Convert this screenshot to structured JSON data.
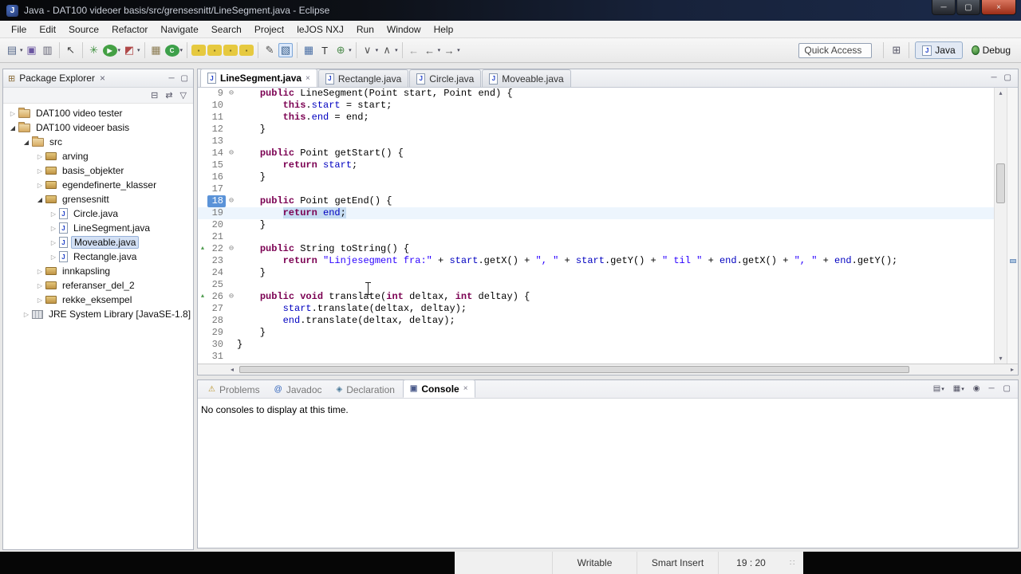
{
  "window": {
    "title": "Java - DAT100 videoer basis/src/grensesnitt/LineSegment.java - Eclipse",
    "app_icon_letter": "J",
    "controls": {
      "minimize": "─",
      "maximize": "▢",
      "close": "×"
    }
  },
  "glyphs": {
    "dropdown": "▾",
    "expander_open": "◢",
    "expander_closed": "▷",
    "fold": "⊖",
    "override_marker": "▲",
    "scroll_up": "▴",
    "scroll_down": "▾",
    "scroll_left": "◂",
    "scroll_right": "▸",
    "minimize": "─",
    "maximize": "▢",
    "close": "×",
    "handle_dots": "∷"
  },
  "menu": {
    "items": [
      "File",
      "Edit",
      "Source",
      "Refactor",
      "Navigate",
      "Search",
      "Project",
      "leJOS NXJ",
      "Run",
      "Window",
      "Help"
    ]
  },
  "toolbar": {
    "quick_access": "Quick Access",
    "icons": [
      {
        "name": "new-wizard",
        "glyph": "▤",
        "color": "#56688a",
        "dd": true
      },
      {
        "name": "save",
        "glyph": "▣",
        "color": "#6a55a0"
      },
      {
        "name": "print",
        "glyph": "▥",
        "color": "#667",
        "sepAfter": true
      },
      {
        "name": "selection-tool",
        "glyph": "↖",
        "color": "#444",
        "sepAfter": true
      },
      {
        "name": "debug",
        "glyph": "✳",
        "color": "#3c8f3c"
      },
      {
        "name": "run",
        "glyph": "▶",
        "color": "#ffffff",
        "bg": "#44a044",
        "circle": true,
        "dd": true
      },
      {
        "name": "coverage",
        "glyph": "◩",
        "color": "#b04848",
        "dd": true,
        "sepAfter": true
      },
      {
        "name": "new-java-project",
        "glyph": "▦",
        "color": "#8a7a50"
      },
      {
        "name": "new-class",
        "glyph": "C",
        "color": "#ffffff",
        "bg": "#3da04a",
        "circle": true,
        "dd": true,
        "sepAfter": true
      },
      {
        "name": "lejos-compile",
        "glyph": "▪",
        "color": "#7a6a20",
        "bg": "#e6c93f",
        "box": true
      },
      {
        "name": "lejos-upload",
        "glyph": "▪",
        "color": "#7a6a20",
        "bg": "#e6c93f",
        "box": true
      },
      {
        "name": "lejos-console",
        "glyph": "▪",
        "color": "#7a6a20",
        "bg": "#e6c93f",
        "box": true
      },
      {
        "name": "lejos-flash",
        "glyph": "▪",
        "color": "#7a6a20",
        "bg": "#e6c93f",
        "box": true,
        "sepAfter": true
      },
      {
        "name": "edit-pen",
        "glyph": "✎",
        "color": "#555"
      },
      {
        "name": "capture",
        "glyph": "▧",
        "color": "#3a5f8a",
        "pressed": true,
        "sepAfter": true
      },
      {
        "name": "new-table",
        "glyph": "▦",
        "color": "#4a6fa5"
      },
      {
        "name": "text-tool",
        "glyph": "T",
        "color": "#333"
      },
      {
        "name": "new-type",
        "glyph": "⊕",
        "color": "#4a8a4a",
        "dd": true,
        "sepAfter": true
      },
      {
        "name": "next-annotation",
        "glyph": "∨",
        "color": "#555",
        "dd": true
      },
      {
        "name": "prev-annotation",
        "glyph": "∧",
        "color": "#555",
        "dd": true,
        "sepAfter": true
      },
      {
        "name": "last-edit-location",
        "glyph": "←",
        "color": "#999"
      },
      {
        "name": "back-history",
        "glyph": "←",
        "color": "#555",
        "dd": true
      },
      {
        "name": "forward-history",
        "glyph": "→",
        "color": "#555",
        "dd": true
      }
    ],
    "perspectives": {
      "open_glyph": "⊞",
      "items": [
        {
          "name": "java",
          "label": "Java",
          "active": true
        },
        {
          "name": "debug",
          "label": "Debug",
          "active": false
        }
      ]
    }
  },
  "package_explorer": {
    "title": "Package Explorer",
    "view_toolbar": [
      {
        "name": "collapse-all",
        "glyph": "⊟"
      },
      {
        "name": "link-with-editor",
        "glyph": "⇄"
      },
      {
        "name": "view-menu",
        "glyph": "▽"
      }
    ],
    "tree": [
      {
        "label": "DAT100 video tester",
        "depth": 0,
        "exp": "closed",
        "icon": "project"
      },
      {
        "label": "DAT100 videoer basis",
        "depth": 0,
        "exp": "open",
        "icon": "project"
      },
      {
        "label": "src",
        "depth": 1,
        "exp": "open",
        "icon": "srcfolder"
      },
      {
        "label": "arving",
        "depth": 2,
        "exp": "closed",
        "icon": "package"
      },
      {
        "label": "basis_objekter",
        "depth": 2,
        "exp": "closed",
        "icon": "package"
      },
      {
        "label": "egendefinerte_klasser",
        "depth": 2,
        "exp": "closed",
        "icon": "package"
      },
      {
        "label": "grensesnitt",
        "depth": 2,
        "exp": "open",
        "icon": "package"
      },
      {
        "label": "Circle.java",
        "depth": 3,
        "exp": "closed",
        "icon": "jfile"
      },
      {
        "label": "LineSegment.java",
        "depth": 3,
        "exp": "closed",
        "icon": "jfile"
      },
      {
        "label": "Moveable.java",
        "depth": 3,
        "exp": "closed",
        "icon": "jfile",
        "selected": true
      },
      {
        "label": "Rectangle.java",
        "depth": 3,
        "exp": "closed",
        "icon": "jfile"
      },
      {
        "label": "innkapsling",
        "depth": 2,
        "exp": "closed",
        "icon": "package"
      },
      {
        "label": "referanser_del_2",
        "depth": 2,
        "exp": "closed",
        "icon": "package"
      },
      {
        "label": "rekke_eksempel",
        "depth": 2,
        "exp": "closed",
        "icon": "package"
      },
      {
        "label": "JRE System Library [JavaSE-1.8]",
        "depth": 1,
        "exp": "closed",
        "icon": "lib"
      }
    ]
  },
  "editor": {
    "tabs": [
      {
        "label": "LineSegment.java",
        "active": true,
        "closable": true
      },
      {
        "label": "Rectangle.java",
        "active": false
      },
      {
        "label": "Circle.java",
        "active": false
      },
      {
        "label": "Moveable.java",
        "active": false
      }
    ],
    "lines": [
      {
        "n": 9,
        "fold": true,
        "segs": [
          [
            "",
            "    "
          ],
          [
            "k",
            "public"
          ],
          [
            "",
            " LineSegment(Point start, Point end) {"
          ]
        ]
      },
      {
        "n": 10,
        "segs": [
          [
            "",
            "        "
          ],
          [
            "k",
            "this"
          ],
          [
            "",
            "."
          ],
          [
            "f",
            "start"
          ],
          [
            "",
            " = start;"
          ]
        ]
      },
      {
        "n": 11,
        "segs": [
          [
            "",
            "        "
          ],
          [
            "k",
            "this"
          ],
          [
            "",
            "."
          ],
          [
            "f",
            "end"
          ],
          [
            "",
            " = end;"
          ]
        ]
      },
      {
        "n": 12,
        "segs": [
          [
            "",
            "    }"
          ]
        ]
      },
      {
        "n": 13,
        "segs": []
      },
      {
        "n": 14,
        "fold": true,
        "segs": [
          [
            "",
            "    "
          ],
          [
            "k",
            "public"
          ],
          [
            "",
            " Point getStart() {"
          ]
        ]
      },
      {
        "n": 15,
        "segs": [
          [
            "",
            "        "
          ],
          [
            "k",
            "return"
          ],
          [
            "",
            " "
          ],
          [
            "f",
            "start"
          ],
          [
            "",
            ";"
          ]
        ]
      },
      {
        "n": 16,
        "segs": [
          [
            "",
            "    }"
          ]
        ]
      },
      {
        "n": 17,
        "segs": []
      },
      {
        "n": 18,
        "fold": true,
        "nhl": true,
        "segs": [
          [
            "",
            "    "
          ],
          [
            "k",
            "public"
          ],
          [
            "",
            " Point getEnd() {"
          ]
        ]
      },
      {
        "n": 19,
        "cur": true,
        "segs": [
          [
            "",
            "        "
          ],
          [
            "k sel",
            "return"
          ],
          [
            "sel",
            " "
          ],
          [
            "f sel",
            "end"
          ],
          [
            "sel",
            ";"
          ]
        ]
      },
      {
        "n": 20,
        "segs": [
          [
            "",
            "    }"
          ]
        ]
      },
      {
        "n": 21,
        "segs": []
      },
      {
        "n": 22,
        "fold": true,
        "ov": true,
        "segs": [
          [
            "",
            "    "
          ],
          [
            "k",
            "public"
          ],
          [
            "",
            " String toString() {"
          ]
        ]
      },
      {
        "n": 23,
        "segs": [
          [
            "",
            "        "
          ],
          [
            "k",
            "return"
          ],
          [
            "",
            " "
          ],
          [
            "s",
            "\"Linjesegment fra:\""
          ],
          [
            "",
            " + "
          ],
          [
            "f",
            "start"
          ],
          [
            "",
            ".getX() + "
          ],
          [
            "s",
            "\", \""
          ],
          [
            "",
            " + "
          ],
          [
            "f",
            "start"
          ],
          [
            "",
            ".getY() + "
          ],
          [
            "s",
            "\" til \""
          ],
          [
            "",
            " + "
          ],
          [
            "f",
            "end"
          ],
          [
            "",
            ".getX() + "
          ],
          [
            "s",
            "\", \""
          ],
          [
            "",
            " + "
          ],
          [
            "f",
            "end"
          ],
          [
            "",
            ".getY();"
          ]
        ]
      },
      {
        "n": 24,
        "segs": [
          [
            "",
            "    }"
          ]
        ]
      },
      {
        "n": 25,
        "segs": []
      },
      {
        "n": 26,
        "fold": true,
        "ov": true,
        "segs": [
          [
            "",
            "    "
          ],
          [
            "k",
            "public"
          ],
          [
            "",
            " "
          ],
          [
            "k",
            "void"
          ],
          [
            "",
            " translate("
          ],
          [
            "k",
            "int"
          ],
          [
            "",
            " deltax, "
          ],
          [
            "k",
            "int"
          ],
          [
            "",
            " deltay) {"
          ]
        ]
      },
      {
        "n": 27,
        "segs": [
          [
            "",
            "        "
          ],
          [
            "f",
            "start"
          ],
          [
            "",
            ".translate(deltax, deltay);"
          ]
        ]
      },
      {
        "n": 28,
        "segs": [
          [
            "",
            "        "
          ],
          [
            "f",
            "end"
          ],
          [
            "",
            ".translate(deltax, deltay);"
          ]
        ]
      },
      {
        "n": 29,
        "segs": [
          [
            "",
            "    }"
          ]
        ]
      },
      {
        "n": 30,
        "segs": [
          [
            "",
            "}"
          ]
        ]
      },
      {
        "n": 31,
        "segs": []
      }
    ]
  },
  "console": {
    "tabs": [
      {
        "name": "problems",
        "icon": "⚠",
        "icolor": "#b8912a",
        "label": "Problems",
        "active": false
      },
      {
        "name": "javadoc",
        "icon": "@",
        "icolor": "#2a5fba",
        "label": "Javadoc",
        "active": false
      },
      {
        "name": "declaration",
        "icon": "◈",
        "icolor": "#4a7a9a",
        "label": "Declaration",
        "active": false
      },
      {
        "name": "console",
        "icon": "▣",
        "icolor": "#4a5a8a",
        "label": "Console",
        "active": true,
        "closable": true
      }
    ],
    "right_icons": [
      {
        "name": "open-console",
        "glyph": "▤",
        "dd": true
      },
      {
        "name": "display-selected-console",
        "glyph": "▦",
        "dd": true
      },
      {
        "name": "pin-console",
        "glyph": "◉"
      },
      {
        "name": "minimize-view",
        "glyph": "─"
      },
      {
        "name": "maximize-view",
        "glyph": "▢"
      }
    ],
    "message": "No consoles to display at this time."
  },
  "status": {
    "writable": "Writable",
    "insert_mode": "Smart Insert",
    "position": "19 : 20"
  }
}
